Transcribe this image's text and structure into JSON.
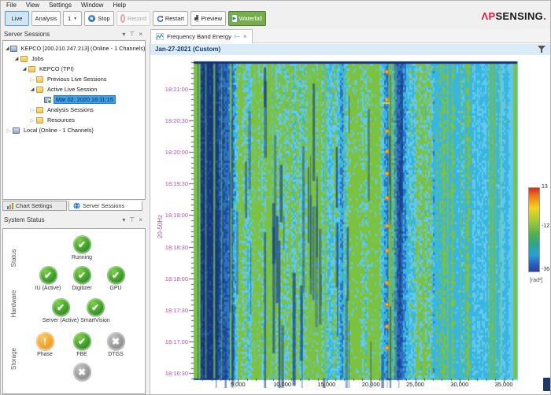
{
  "menu": {
    "items": [
      "File",
      "View",
      "Settings",
      "Window",
      "Help"
    ]
  },
  "toolbar": {
    "live": "Live",
    "analysis": "Analysis",
    "channel_value": "1",
    "stop": "Stop",
    "record": "Record",
    "restart": "Restart",
    "preview": "Preview",
    "waterfall": "Waterfall"
  },
  "logo": {
    "part1": "ΛP",
    "part2": "SENSING",
    "dot": ".",
    "accent": "#e8173d"
  },
  "server_sessions": {
    "title": "Server Sessions",
    "tree": [
      {
        "label": "KEPCO [200.210.247.213] (Online - 1 Channels)",
        "level": 0,
        "expander": "expanded",
        "icon": "server",
        "selected": false
      },
      {
        "label": "Jobs",
        "level": 1,
        "expander": "expanded",
        "icon": "folder",
        "selected": false
      },
      {
        "label": "KEPCO (TPI)",
        "level": 2,
        "expander": "expanded",
        "icon": "folder",
        "selected": false
      },
      {
        "label": "Previous Live Sessions",
        "level": 3,
        "expander": "collapsed",
        "icon": "folder",
        "selected": false
      },
      {
        "label": "Active Live Session",
        "level": 3,
        "expander": "expanded",
        "icon": "folder",
        "selected": false
      },
      {
        "label": "Mar 02, 2020 16:11:15",
        "level": 4,
        "expander": "none",
        "icon": "session",
        "selected": true
      },
      {
        "label": "Analysis Sessions",
        "level": 3,
        "expander": "collapsed",
        "icon": "folder",
        "selected": false
      },
      {
        "label": "Resources",
        "level": 3,
        "expander": "collapsed",
        "icon": "folder",
        "selected": false
      },
      {
        "label": "Local (Online - 1 Channels)",
        "level": 0,
        "expander": "collapsed",
        "icon": "server",
        "selected": false
      }
    ],
    "tabs": [
      {
        "label": "Chart Settings",
        "icon": "chart",
        "active": false
      },
      {
        "label": "Server Sessions",
        "icon": "globe",
        "active": true
      }
    ]
  },
  "system_status": {
    "title": "System Status",
    "groups": [
      {
        "label": "Status",
        "rows": [
          [
            {
              "label": "Running",
              "state": "ok"
            }
          ]
        ]
      },
      {
        "label": "Hardware",
        "rows": [
          [
            {
              "label": "IU (Active)",
              "state": "ok"
            },
            {
              "label": "Digitizer",
              "state": "ok"
            },
            {
              "label": "GPU",
              "state": "ok"
            }
          ],
          [
            {
              "label": "Server (Active)",
              "state": "ok"
            },
            {
              "label": "SmartVision",
              "state": "ok"
            }
          ]
        ]
      },
      {
        "label": "Storage",
        "rows": [
          [
            {
              "label": "Phase",
              "state": "warning"
            },
            {
              "label": "FBE",
              "state": "ok"
            },
            {
              "label": "DTGS",
              "state": "off"
            }
          ],
          [
            {
              "label": "",
              "state": "off"
            }
          ]
        ]
      }
    ]
  },
  "main": {
    "tab": {
      "label": "Frequency Band Energy"
    },
    "header": {
      "label": "Jan-27-2021 (Custom)"
    }
  },
  "chart_data": {
    "type": "heatmap",
    "title": "Jan-27-2021 (Custom)",
    "xlabel": "",
    "ylabel": "20-50Hz",
    "x_range": [
      0,
      36500
    ],
    "x_ticks": [
      5000,
      10000,
      15000,
      20000,
      25000,
      30000,
      35000
    ],
    "x_minor_step": 1000,
    "y_top": "18:21:26",
    "y_bottom": "18:16:25",
    "y_ticks": [
      "18:21:00",
      "18:20:30",
      "18:20:00",
      "18:19:30",
      "18:19:00",
      "18:18:30",
      "18:18:00",
      "18:17:30",
      "18:17:00",
      "18:16:30"
    ],
    "y_minor_step_s": 5,
    "colorbar": {
      "max": "13",
      "mid": "-12",
      "min": "-36",
      "unit": "[rad²]"
    },
    "palette": [
      "#16387e",
      "#1d4f9e",
      "#2e72c4",
      "#38b6e0",
      "#63c9ec",
      "#7cc242"
    ],
    "event_column": {
      "x": 21800,
      "color": "#f5a623",
      "note": "vertical column of yellow-orange energy hotspots"
    },
    "description": "Waterfall of 20-50Hz frequency band energy vs fiber distance (0-36,500) and time (18:16:25-18:21:26). Dense vertical blue/cyan/green streak texture; lighter cyan zone beyond ~28,000; green bands at both edges; orange hotspot column near 21,800."
  }
}
